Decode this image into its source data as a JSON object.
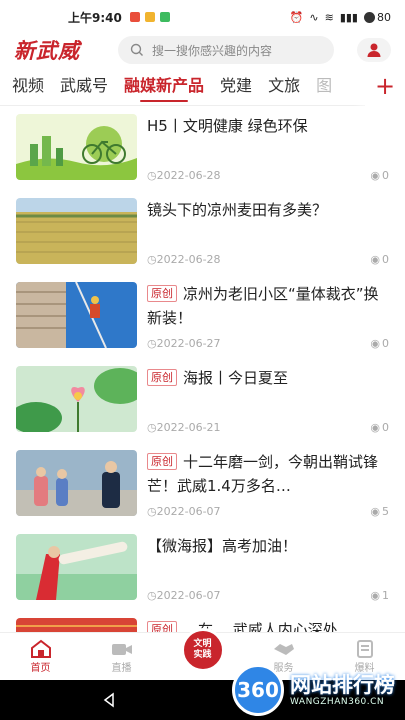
{
  "status": {
    "time": "上午9:40",
    "battery": "80"
  },
  "header": {
    "logo": "新武威",
    "search_placeholder": "搜一搜你感兴趣的内容"
  },
  "tabs": [
    "视频",
    "武威号",
    "融媒新产品",
    "党建",
    "文旅",
    "图"
  ],
  "active_tab": 2,
  "articles": [
    {
      "title": "H5丨文明健康 绿色环保",
      "tag": "",
      "date": "2022-06-28",
      "views": "0"
    },
    {
      "title": "镜头下的凉州麦田有多美？",
      "tag": "",
      "date": "2022-06-28",
      "views": "0"
    },
    {
      "title": "凉州为老旧小区“量体裁衣”换新装！",
      "tag": "原创",
      "date": "2022-06-27",
      "views": "0"
    },
    {
      "title": "海报丨今日夏至",
      "tag": "原创",
      "date": "2022-06-21",
      "views": "0"
    },
    {
      "title": "十二年磨一剑，今朝出鞘试锋芒！武威1.4万多名…",
      "tag": "原创",
      "date": "2022-06-07",
      "views": "5"
    },
    {
      "title": "【微海报】高考加油！",
      "tag": "",
      "date": "2022-06-07",
      "views": "1"
    },
    {
      "title": "…在… 武威人内心深处",
      "tag": "原创",
      "date": "",
      "views": ""
    }
  ],
  "bottom_nav": {
    "home": "首页",
    "live": "直播",
    "center_line1": "文明",
    "center_line2": "实践",
    "service": "服务",
    "report": "爆料"
  },
  "watermark": {
    "badge": "360",
    "text": "网站排行榜",
    "sub": "WANGZHAN360.CN"
  },
  "colors": {
    "accent": "#c9252c",
    "watermark_blue": "#2f86e6"
  }
}
